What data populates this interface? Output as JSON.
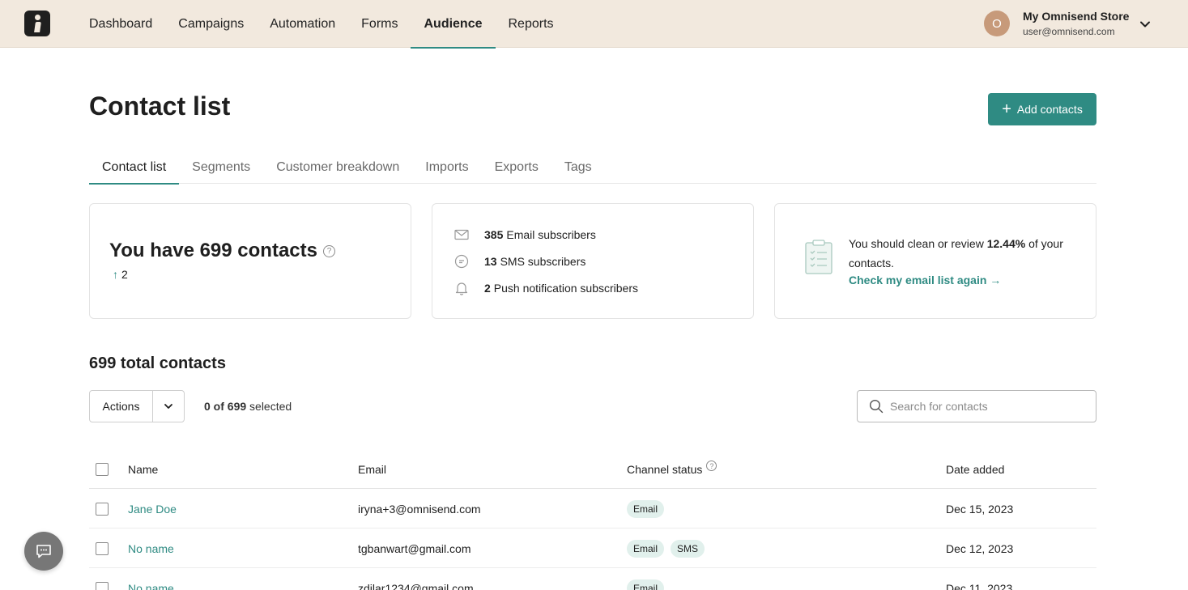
{
  "nav": {
    "items": [
      {
        "label": "Dashboard"
      },
      {
        "label": "Campaigns"
      },
      {
        "label": "Automation"
      },
      {
        "label": "Forms"
      },
      {
        "label": "Audience",
        "active": true
      },
      {
        "label": "Reports"
      }
    ]
  },
  "account": {
    "initial": "O",
    "store_name": "My Omnisend Store",
    "email": "user@omnisend.com"
  },
  "header": {
    "title": "Contact list",
    "add_button": "Add contacts"
  },
  "tabs": [
    {
      "label": "Contact list",
      "active": true
    },
    {
      "label": "Segments"
    },
    {
      "label": "Customer breakdown"
    },
    {
      "label": "Imports"
    },
    {
      "label": "Exports"
    },
    {
      "label": "Tags"
    }
  ],
  "summary": {
    "contacts_heading": "You have 699 contacts",
    "growth": "2"
  },
  "subscribers": [
    {
      "count": "385",
      "label": "Email subscribers",
      "icon": "envelope-icon"
    },
    {
      "count": "13",
      "label": "SMS subscribers",
      "icon": "chat-bubble-icon"
    },
    {
      "count": "2",
      "label": "Push notification subscribers",
      "icon": "bell-icon"
    }
  ],
  "clean": {
    "text_before": "You should clean or review ",
    "percent": "12.44%",
    "text_after": " of your contacts.",
    "link": "Check my email list again →"
  },
  "table": {
    "total_title": "699 total contacts",
    "actions_label": "Actions",
    "selected_count": "0 of 699",
    "selected_suffix": " selected",
    "search_placeholder": "Search for contacts",
    "columns": {
      "name": "Name",
      "email": "Email",
      "channel_status": "Channel status",
      "date_added": "Date added"
    },
    "rows": [
      {
        "name": "Jane Doe",
        "email": "iryna+3@omnisend.com",
        "channels": [
          "Email"
        ],
        "date": "Dec 15, 2023"
      },
      {
        "name": "No name",
        "email": "tgbanwart@gmail.com",
        "channels": [
          "Email",
          "SMS"
        ],
        "date": "Dec 12, 2023"
      },
      {
        "name": "No name",
        "email": "zdilar1234@gmail.com",
        "channels": [
          "Email"
        ],
        "date": "Dec 11, 2023"
      }
    ]
  },
  "colors": {
    "accent": "#2f8b83",
    "topbar": "#f2e9de",
    "pill": "#e1f0ec"
  }
}
